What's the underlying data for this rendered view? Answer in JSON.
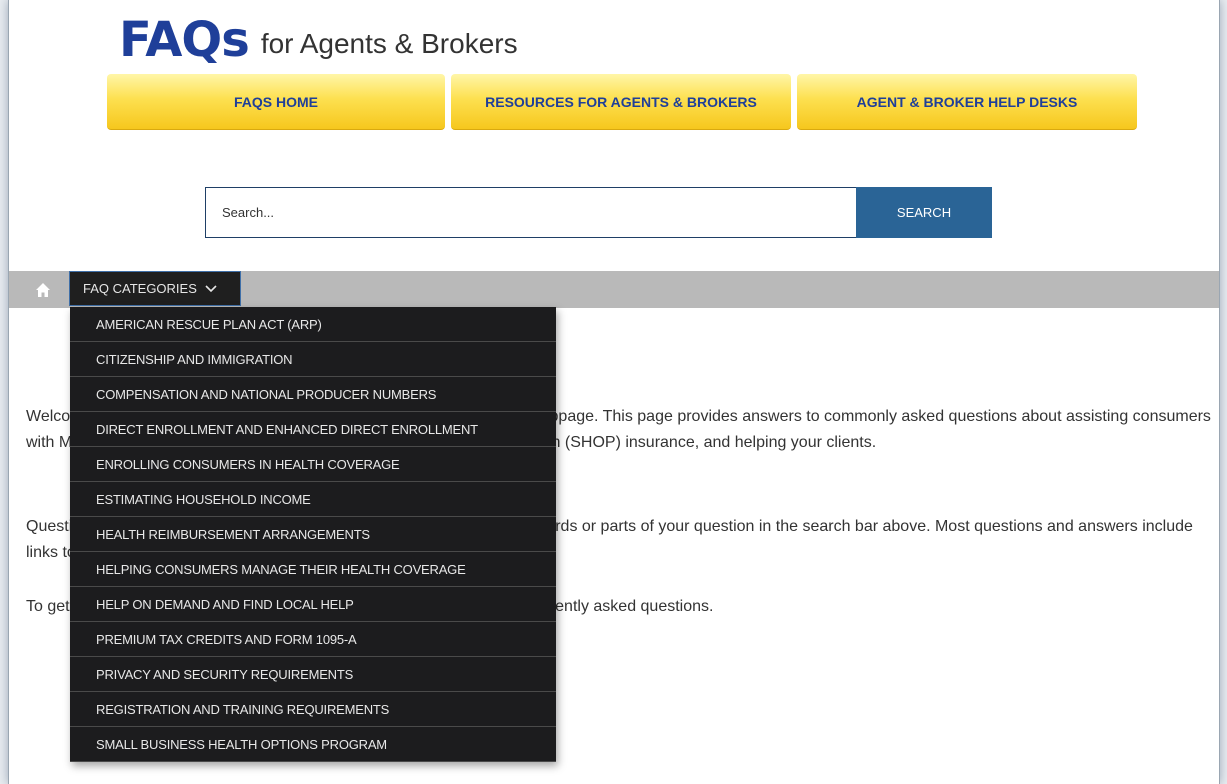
{
  "logo": {
    "faqs": "FAQs",
    "subtitle": "for Agents & Brokers"
  },
  "nav": [
    {
      "label": "FAQS HOME"
    },
    {
      "label": "RESOURCES FOR AGENTS & BROKERS"
    },
    {
      "label": "AGENT & BROKER HELP DESKS"
    }
  ],
  "search": {
    "placeholder": "Search...",
    "value": "",
    "button_label": "SEARCH"
  },
  "breadcrumb": {
    "home_icon": "home-icon",
    "categories_label": "FAQ CATEGORIES"
  },
  "categories_menu": [
    "AMERICAN RESCUE PLAN ACT (ARP)",
    "CITIZENSHIP AND IMMIGRATION",
    "COMPENSATION AND NATIONAL PRODUCER NUMBERS",
    "DIRECT ENROLLMENT AND ENHANCED DIRECT ENROLLMENT",
    "ENROLLING CONSUMERS IN HEALTH COVERAGE",
    "ESTIMATING HOUSEHOLD INCOME",
    "HEALTH REIMBURSEMENT ARRANGEMENTS",
    "HELPING CONSUMERS MANAGE THEIR HEALTH COVERAGE",
    "HELP ON DEMAND AND FIND LOCAL HELP",
    "PREMIUM TAX CREDITS AND FORM 1095-A",
    "PRIVACY AND SECURITY REQUIREMENTS",
    "REGISTRATION AND TRAINING REQUIREMENTS",
    "SMALL BUSINESS HEALTH OPTIONS PROGRAM"
  ],
  "body": {
    "p1": "Welcome to the Agent and Broker Frequently Asked Questions (FAQs) webpage. This page provides answers to commonly asked questions about assisting consumers with Marketplace coverage, selling Small Business Health Options Program (SHOP) insurance, and helping your clients.",
    "p2": "Questions and answers on this webpage can be searched by typing keywords or parts of your question in the search bar above. Most questions and answers include links to resources to help you when assisting your clients.",
    "p3": "To get started, select a category from “FAQ Categories” above to find frequently asked questions."
  },
  "colors": {
    "brand_blue": "#1f3f99",
    "nav_gold": "#fde050",
    "search_button": "#2a6496",
    "menu_bg": "#1c1c1e",
    "bar_gray": "#b9b9b9"
  }
}
